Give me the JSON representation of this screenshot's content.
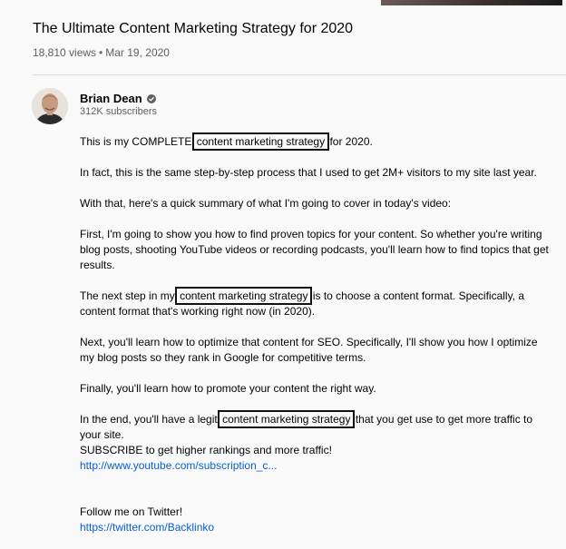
{
  "video": {
    "title": "The Ultimate Content Marketing Strategy for 2020",
    "views": "18,810 views",
    "date": "Mar 19, 2020"
  },
  "channel": {
    "name": "Brian Dean",
    "subscribers": "312K subscribers",
    "verified_icon": "verified-check-icon"
  },
  "description": {
    "p1": {
      "before": "This is my COMPLETE",
      "highlight": "content marketing strategy",
      "after": "for 2020."
    },
    "p2": "In fact, this is the same step-by-step process that I used to get 2M+ visitors to my site last year.",
    "p3": "With that, here's a quick summary of what I'm going to cover in today's video:",
    "p4": "First, I'm going to show you how to find proven topics for your content. So whether you're writing blog posts, shooting YouTube videos or recording podcasts, you'll learn how to find topics that get results.",
    "p5": {
      "before": "The next step in my",
      "highlight": "content marketing strategy",
      "after": "is to choose a content format. Specifically, a content format that's working right now (in 2020)."
    },
    "p6": "Next, you'll learn how to optimize that content for SEO. Specifically, I'll show you how I optimize my blog posts so they rank in Google for competitive terms.",
    "p7": "Finally, you'll learn how to promote your content the right way.",
    "p8": {
      "before": "In the end, you'll have a legit",
      "highlight": "content marketing strategy",
      "after": "that you get use to get more traffic to your site."
    },
    "subscribe_text": "SUBSCRIBE to get higher rankings and more traffic!",
    "subscribe_link": "http://www.youtube.com/subscription_c...",
    "twitter_text": "Follow me on Twitter!",
    "twitter_link": "https://twitter.com/Backlinko"
  }
}
